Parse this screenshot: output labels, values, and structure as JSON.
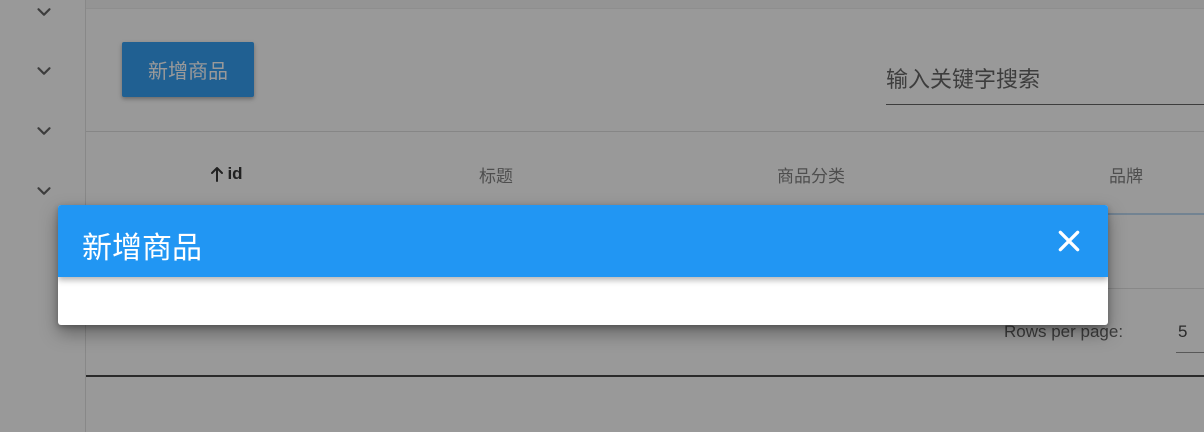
{
  "sidebar": {
    "items": [
      {
        "icon": "chevron-down-icon"
      },
      {
        "icon": "chevron-down-icon"
      },
      {
        "icon": "chevron-down-icon"
      },
      {
        "icon": "chevron-down-icon"
      }
    ]
  },
  "toolbar": {
    "add_label": "新增商品",
    "search_placeholder": "输入关键字搜索"
  },
  "table": {
    "columns": [
      {
        "label": "id",
        "sorted": "ascending",
        "sort_icon": "arrow-up-icon"
      },
      {
        "label": "标题"
      },
      {
        "label": "商品分类"
      },
      {
        "label": "品牌"
      }
    ],
    "rows_per_page_label": "Rows per page:",
    "rows_per_page_value": "5"
  },
  "dialog": {
    "title": "新增商品",
    "close_icon": "close-icon"
  },
  "colors": {
    "primary": "#2196f3",
    "overlay": "#212121"
  }
}
